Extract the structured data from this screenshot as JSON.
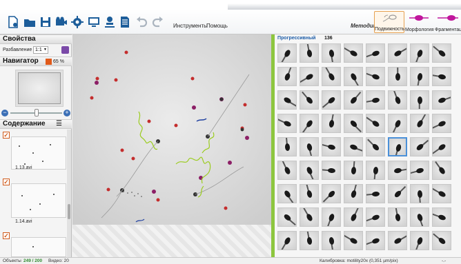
{
  "menu": {
    "tools": "Инструменты",
    "help": "Помощь"
  },
  "methods": {
    "label": "Методики",
    "items": [
      {
        "label": "Подвижность",
        "active": true
      },
      {
        "label": "Морфология",
        "active": false
      },
      {
        "label": "Фрагментация",
        "active": false
      }
    ]
  },
  "properties": {
    "title": "Свойства",
    "resolution_label": "Разбавление",
    "resolution_value": "1:1"
  },
  "navigator": {
    "title": "Навигатор",
    "zoom": "65 %"
  },
  "contents": {
    "title": "Содержание",
    "items": [
      {
        "name": "1.13.avi"
      },
      {
        "name": "1.14.avi"
      }
    ]
  },
  "gallery": {
    "title": "Прогрессивный",
    "count": "136",
    "selected_cell": 37
  },
  "status": {
    "objects_label": "Объекты",
    "objects_value": "249 / 200",
    "video_label": "Видео: 20",
    "calibration": "Калибровка: motility20x (0,351 µm/pix)",
    "extra": "-.-"
  },
  "colors": {
    "accent_green": "#8dc63f",
    "selection_blue": "#4a90d9",
    "brand_purple": "#c0169c",
    "check_orange": "#d05a1a"
  }
}
